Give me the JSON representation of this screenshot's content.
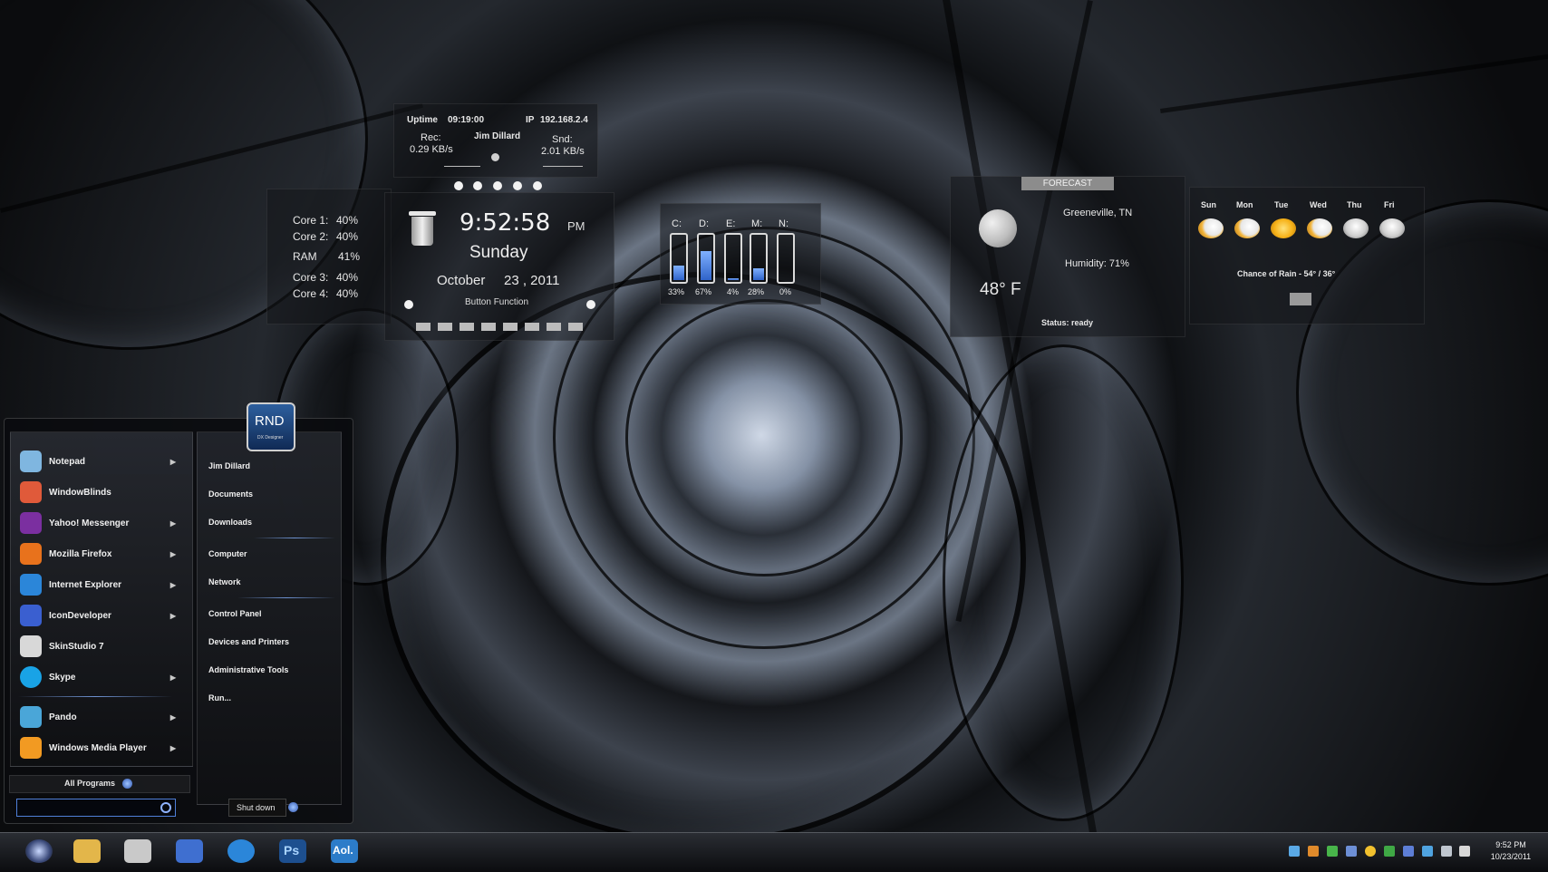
{
  "netmon": {
    "uptime_label": "Uptime",
    "uptime_value": "09:19:00",
    "ip_label": "IP",
    "ip_value": "192.168.2.4",
    "user_name": "Jim Dillard",
    "rec_label": "Rec:",
    "rec_value": "0.29 KB/s",
    "snd_label": "Snd:",
    "snd_value": "2.01 KB/s"
  },
  "cpu": {
    "rows": [
      {
        "label": "Core 1:",
        "value": "40%"
      },
      {
        "label": "Core 2:",
        "value": "40%"
      },
      {
        "label": "RAM",
        "value": "41%"
      },
      {
        "label": "Core 3:",
        "value": "40%"
      },
      {
        "label": "Core 4:",
        "value": "40%"
      }
    ]
  },
  "clock": {
    "time": "9:52:58",
    "ampm": "PM",
    "day": "Sunday",
    "month": "October",
    "date": "23 , 2011",
    "button_label": "Button Function"
  },
  "drives": [
    {
      "label": "C:",
      "percent_text": "33%",
      "fill": 0.33
    },
    {
      "label": "D:",
      "percent_text": "67%",
      "fill": 0.67
    },
    {
      "label": "E:",
      "percent_text": "4%",
      "fill": 0.04
    },
    {
      "label": "M:",
      "percent_text": "28%",
      "fill": 0.28
    },
    {
      "label": "N:",
      "percent_text": "0%",
      "fill": 0.0
    }
  ],
  "weather": {
    "forecast_label": "FORECAST",
    "city": "Greeneville, TN",
    "humidity": "Humidity: 71%",
    "temp": "48° F",
    "status": "Status: ready",
    "days": [
      {
        "label": "Sun",
        "icon": "partly-cloudy-icon"
      },
      {
        "label": "Mon",
        "icon": "partly-cloudy-icon"
      },
      {
        "label": "Tue",
        "icon": "sunny-icon"
      },
      {
        "label": "Wed",
        "icon": "partly-cloudy-icon"
      },
      {
        "label": "Thu",
        "icon": "cloudy-sun-icon"
      },
      {
        "label": "Fri",
        "icon": "storm-icon"
      }
    ],
    "chance_of_rain": "Chance of Rain - 54° / 36°"
  },
  "start_menu": {
    "badge_title": "RND",
    "badge_subtitle": "DX Designer",
    "programs": [
      {
        "label": "Notepad",
        "icon": "notepad-icon",
        "color": "#7fb6e0",
        "arrow": true
      },
      {
        "label": "WindowBlinds",
        "icon": "windowblinds-icon",
        "color": "#e05a3a",
        "arrow": false
      },
      {
        "label": "Yahoo! Messenger",
        "icon": "yahoo-messenger-icon",
        "color": "#7b2fa0",
        "arrow": true
      },
      {
        "label": "Mozilla Firefox",
        "icon": "firefox-icon",
        "color": "#e8721c",
        "arrow": true
      },
      {
        "label": "Internet Explorer",
        "icon": "internet-explorer-icon",
        "color": "#2b86d9",
        "arrow": true
      },
      {
        "label": "IconDeveloper",
        "icon": "icondeveloper-icon",
        "color": "#3a5fd0",
        "arrow": true
      },
      {
        "label": "SkinStudio 7",
        "icon": "skinstudio-icon",
        "color": "#d8d8d8",
        "arrow": false
      },
      {
        "label": "Skype",
        "icon": "skype-icon",
        "color": "#19a3e6",
        "arrow": true
      },
      {
        "label": "Pando",
        "icon": "pando-icon",
        "color": "#4aa6d8",
        "arrow": true
      },
      {
        "label": "Windows Media Player",
        "icon": "media-player-icon",
        "color": "#f29a22",
        "arrow": true
      }
    ],
    "all_programs": "All Programs",
    "places": [
      {
        "label": "Jim Dillard"
      },
      {
        "label": "Documents"
      },
      {
        "label": "Downloads"
      },
      {
        "label": "Computer"
      },
      {
        "label": "Network"
      },
      {
        "label": "Control Panel"
      },
      {
        "label": "Devices and Printers"
      },
      {
        "label": "Administrative Tools"
      },
      {
        "label": "Run..."
      }
    ],
    "shutdown_label": "Shut down"
  },
  "taskbar": {
    "pinned": [
      {
        "name": "start-orb-icon",
        "color": "#3b4a7a"
      },
      {
        "name": "file-explorer-icon",
        "color": "#e3b64a"
      },
      {
        "name": "paint-icon",
        "color": "#c9c9c9"
      },
      {
        "name": "icondeveloper-taskbar-icon",
        "color": "#3f6fd0"
      },
      {
        "name": "internet-explorer-taskbar-icon",
        "color": "#2b86d9"
      },
      {
        "name": "photoshop-icon",
        "color": "#1d4f8f"
      },
      {
        "name": "aol-icon",
        "color": "#2c7cc9"
      }
    ],
    "photoshop_label": "Ps",
    "aol_label": "Aol.",
    "clock_time": "9:52 PM",
    "clock_date": "10/23/2011"
  }
}
